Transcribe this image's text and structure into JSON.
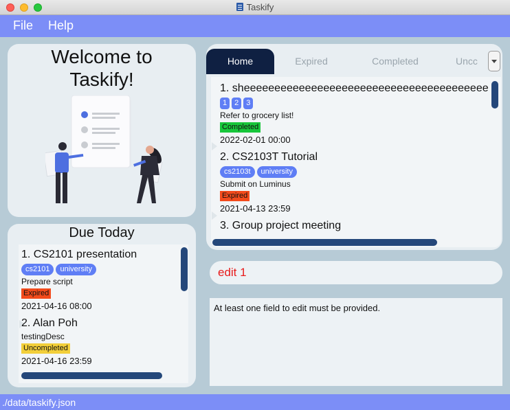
{
  "window": {
    "title": "Taskify"
  },
  "menu": {
    "file": "File",
    "help": "Help"
  },
  "welcome": {
    "title_line1": "Welcome to",
    "title_line2": "Taskify!"
  },
  "due_today": {
    "title": "Due Today",
    "tasks": [
      {
        "name": "1. CS2101 presentation",
        "tags": [
          "cs2101",
          "university"
        ],
        "description": "Prepare script",
        "status": "Expired",
        "date": "2021-04-16 08:00"
      },
      {
        "name": "2. Alan Poh",
        "tags": [],
        "description": "testingDesc",
        "status": "Uncompleted",
        "date": "2021-04-16 23:59"
      }
    ]
  },
  "tabs": [
    "Home",
    "Expired",
    "Completed",
    "Uncc"
  ],
  "task_list": [
    {
      "name": "1. sheeeeeeeeeeeeeeeeeeeeeeeeeeeeeeeeeeeeeeee",
      "tags": [
        "1",
        "2",
        "3"
      ],
      "description": "Refer to grocery list!",
      "status": "Completed",
      "date": "2022-02-01 00:00"
    },
    {
      "name": "2. CS2103T Tutorial",
      "tags": [
        "cs2103t",
        "university"
      ],
      "description": "Submit on Luminus",
      "status": "Expired",
      "date": "2021-04-13 23:59"
    },
    {
      "name": "3. Group project meeting",
      "tags": []
    }
  ],
  "command": {
    "value": "edit 1"
  },
  "result": {
    "message": "At least one field to edit must be provided."
  },
  "status_bar": {
    "path": "./data/taskify.json"
  },
  "colors": {
    "accent": "#7c8ef7",
    "tab_active": "#0f2042",
    "tag": "#5f7ef5",
    "completed": "#17c63a",
    "expired": "#f34b1c",
    "uncompleted": "#f2cf3a",
    "command_text": "#e81a1a"
  }
}
